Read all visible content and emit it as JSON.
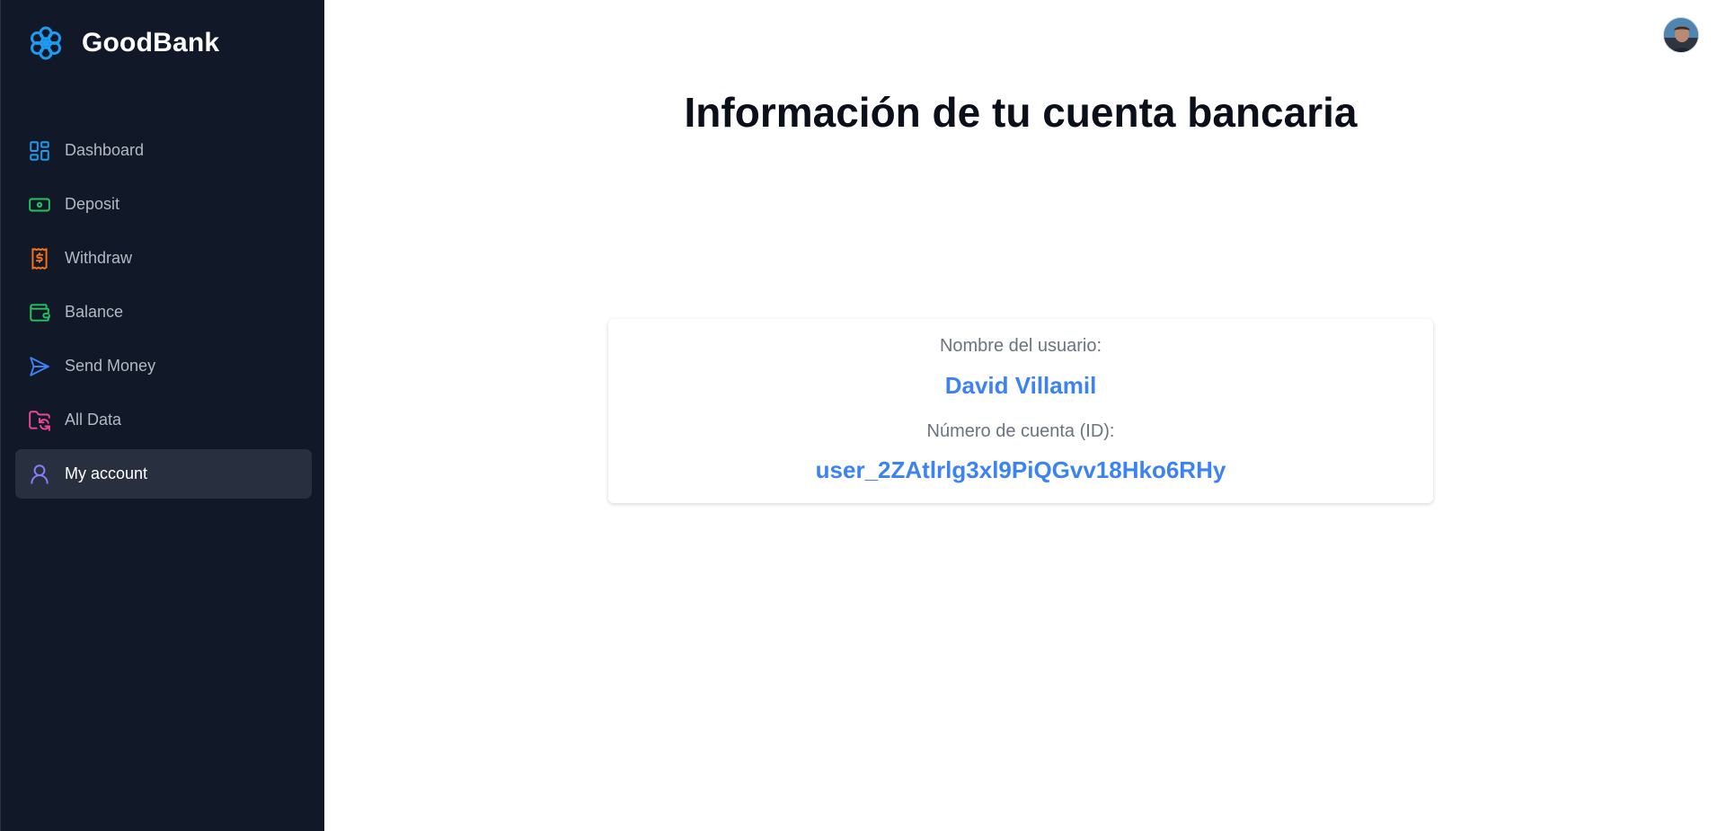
{
  "brand": {
    "name": "GoodBank",
    "accent": "#1d9bf0"
  },
  "sidebar": {
    "items": [
      {
        "label": "Dashboard",
        "icon": "dashboard-icon",
        "color": "#1d9bf0",
        "active": false
      },
      {
        "label": "Deposit",
        "icon": "banknote-icon",
        "color": "#22c55e",
        "active": false
      },
      {
        "label": "Withdraw",
        "icon": "receipt-dollar-icon",
        "color": "#f97316",
        "active": false
      },
      {
        "label": "Balance",
        "icon": "wallet-icon",
        "color": "#22c55e",
        "active": false
      },
      {
        "label": "Send Money",
        "icon": "send-icon",
        "color": "#3b82f6",
        "active": false
      },
      {
        "label": "All Data",
        "icon": "folder-sync-icon",
        "color": "#ec4899",
        "active": false
      },
      {
        "label": "My account",
        "icon": "user-icon",
        "color": "#8b7cf6",
        "active": true
      }
    ]
  },
  "header": {
    "avatar": "user-avatar"
  },
  "main": {
    "title": "Información de tu cuenta bancaria",
    "card": {
      "username_label": "Nombre del usuario:",
      "username_value": "David Villamil",
      "account_label": "Número de cuenta (ID):",
      "account_value": "user_2ZAtlrlg3xl9PiQGvv18Hko6RHy"
    }
  },
  "colors": {
    "sidebar_bg": "#111827",
    "active_bg": "#283040",
    "value_blue": "#3b82f6",
    "label_gray": "#6b7280"
  }
}
